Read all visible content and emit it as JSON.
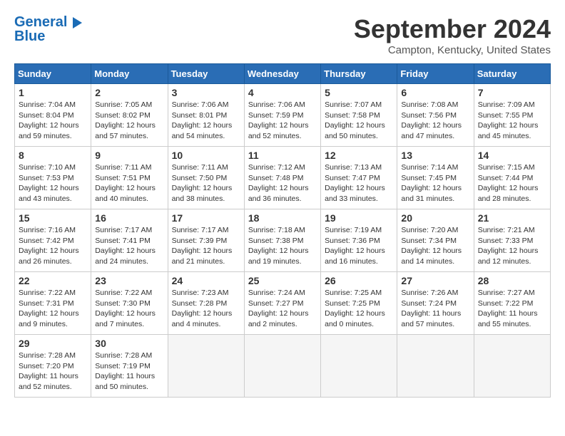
{
  "header": {
    "logo_line1": "General",
    "logo_line2": "Blue",
    "title": "September 2024",
    "location": "Campton, Kentucky, United States"
  },
  "weekdays": [
    "Sunday",
    "Monday",
    "Tuesday",
    "Wednesday",
    "Thursday",
    "Friday",
    "Saturday"
  ],
  "weeks": [
    [
      {
        "day": "1",
        "info": "Sunrise: 7:04 AM\nSunset: 8:04 PM\nDaylight: 12 hours\nand 59 minutes."
      },
      {
        "day": "2",
        "info": "Sunrise: 7:05 AM\nSunset: 8:02 PM\nDaylight: 12 hours\nand 57 minutes."
      },
      {
        "day": "3",
        "info": "Sunrise: 7:06 AM\nSunset: 8:01 PM\nDaylight: 12 hours\nand 54 minutes."
      },
      {
        "day": "4",
        "info": "Sunrise: 7:06 AM\nSunset: 7:59 PM\nDaylight: 12 hours\nand 52 minutes."
      },
      {
        "day": "5",
        "info": "Sunrise: 7:07 AM\nSunset: 7:58 PM\nDaylight: 12 hours\nand 50 minutes."
      },
      {
        "day": "6",
        "info": "Sunrise: 7:08 AM\nSunset: 7:56 PM\nDaylight: 12 hours\nand 47 minutes."
      },
      {
        "day": "7",
        "info": "Sunrise: 7:09 AM\nSunset: 7:55 PM\nDaylight: 12 hours\nand 45 minutes."
      }
    ],
    [
      {
        "day": "8",
        "info": "Sunrise: 7:10 AM\nSunset: 7:53 PM\nDaylight: 12 hours\nand 43 minutes."
      },
      {
        "day": "9",
        "info": "Sunrise: 7:11 AM\nSunset: 7:51 PM\nDaylight: 12 hours\nand 40 minutes."
      },
      {
        "day": "10",
        "info": "Sunrise: 7:11 AM\nSunset: 7:50 PM\nDaylight: 12 hours\nand 38 minutes."
      },
      {
        "day": "11",
        "info": "Sunrise: 7:12 AM\nSunset: 7:48 PM\nDaylight: 12 hours\nand 36 minutes."
      },
      {
        "day": "12",
        "info": "Sunrise: 7:13 AM\nSunset: 7:47 PM\nDaylight: 12 hours\nand 33 minutes."
      },
      {
        "day": "13",
        "info": "Sunrise: 7:14 AM\nSunset: 7:45 PM\nDaylight: 12 hours\nand 31 minutes."
      },
      {
        "day": "14",
        "info": "Sunrise: 7:15 AM\nSunset: 7:44 PM\nDaylight: 12 hours\nand 28 minutes."
      }
    ],
    [
      {
        "day": "15",
        "info": "Sunrise: 7:16 AM\nSunset: 7:42 PM\nDaylight: 12 hours\nand 26 minutes."
      },
      {
        "day": "16",
        "info": "Sunrise: 7:17 AM\nSunset: 7:41 PM\nDaylight: 12 hours\nand 24 minutes."
      },
      {
        "day": "17",
        "info": "Sunrise: 7:17 AM\nSunset: 7:39 PM\nDaylight: 12 hours\nand 21 minutes."
      },
      {
        "day": "18",
        "info": "Sunrise: 7:18 AM\nSunset: 7:38 PM\nDaylight: 12 hours\nand 19 minutes."
      },
      {
        "day": "19",
        "info": "Sunrise: 7:19 AM\nSunset: 7:36 PM\nDaylight: 12 hours\nand 16 minutes."
      },
      {
        "day": "20",
        "info": "Sunrise: 7:20 AM\nSunset: 7:34 PM\nDaylight: 12 hours\nand 14 minutes."
      },
      {
        "day": "21",
        "info": "Sunrise: 7:21 AM\nSunset: 7:33 PM\nDaylight: 12 hours\nand 12 minutes."
      }
    ],
    [
      {
        "day": "22",
        "info": "Sunrise: 7:22 AM\nSunset: 7:31 PM\nDaylight: 12 hours\nand 9 minutes."
      },
      {
        "day": "23",
        "info": "Sunrise: 7:22 AM\nSunset: 7:30 PM\nDaylight: 12 hours\nand 7 minutes."
      },
      {
        "day": "24",
        "info": "Sunrise: 7:23 AM\nSunset: 7:28 PM\nDaylight: 12 hours\nand 4 minutes."
      },
      {
        "day": "25",
        "info": "Sunrise: 7:24 AM\nSunset: 7:27 PM\nDaylight: 12 hours\nand 2 minutes."
      },
      {
        "day": "26",
        "info": "Sunrise: 7:25 AM\nSunset: 7:25 PM\nDaylight: 12 hours\nand 0 minutes."
      },
      {
        "day": "27",
        "info": "Sunrise: 7:26 AM\nSunset: 7:24 PM\nDaylight: 11 hours\nand 57 minutes."
      },
      {
        "day": "28",
        "info": "Sunrise: 7:27 AM\nSunset: 7:22 PM\nDaylight: 11 hours\nand 55 minutes."
      }
    ],
    [
      {
        "day": "29",
        "info": "Sunrise: 7:28 AM\nSunset: 7:20 PM\nDaylight: 11 hours\nand 52 minutes."
      },
      {
        "day": "30",
        "info": "Sunrise: 7:28 AM\nSunset: 7:19 PM\nDaylight: 11 hours\nand 50 minutes."
      },
      {
        "day": "",
        "info": ""
      },
      {
        "day": "",
        "info": ""
      },
      {
        "day": "",
        "info": ""
      },
      {
        "day": "",
        "info": ""
      },
      {
        "day": "",
        "info": ""
      }
    ]
  ]
}
